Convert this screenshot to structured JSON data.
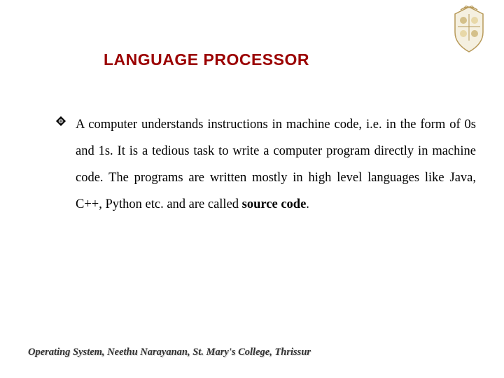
{
  "heading": "LANGUAGE PROCESSOR",
  "body": {
    "part1": "A computer understands instructions in machine code, i.e. in the form of 0s and 1s. It is a tedious task to write a computer program directly in machine code. The programs are written mostly in high level languages like Java, C++, Python etc. and are called ",
    "bold": "source code",
    "part2": "."
  },
  "footer": "Operating System, Neethu Narayanan, St. Mary's College, Thrissur"
}
